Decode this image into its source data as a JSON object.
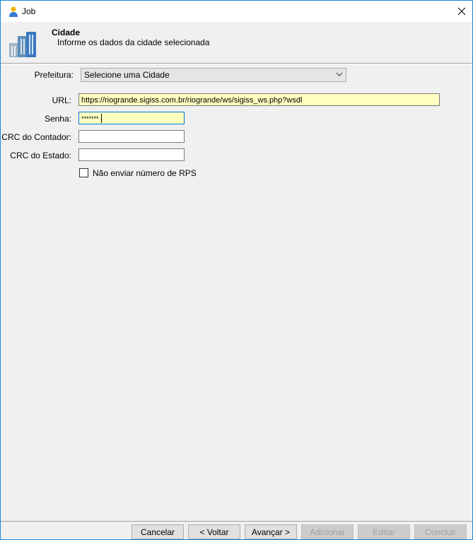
{
  "window": {
    "title": "Job"
  },
  "header": {
    "title": "Cidade",
    "subtitle": "Informe os dados da cidade selecionada"
  },
  "form": {
    "prefeitura_label": "Prefeitura:",
    "prefeitura_value": "Selecione uma Cidade",
    "url_label": "URL:",
    "url_value": "https://riogrande.sigiss.com.br/riogrande/ws/sigiss_ws.php?wsdl",
    "senha_label": "Senha:",
    "senha_value": "*******",
    "crc_contador_label": "CRC do Contador:",
    "crc_contador_value": "",
    "crc_estado_label": "CRC do Estado:",
    "crc_estado_value": "",
    "rps_checkbox_label": "Não enviar número de RPS",
    "rps_checked": false
  },
  "footer": {
    "cancel": "Cancelar",
    "back": "< Voltar",
    "next": "Avançar >",
    "add": "Adicionar",
    "edit": "Editar",
    "finish": "Concluir"
  }
}
